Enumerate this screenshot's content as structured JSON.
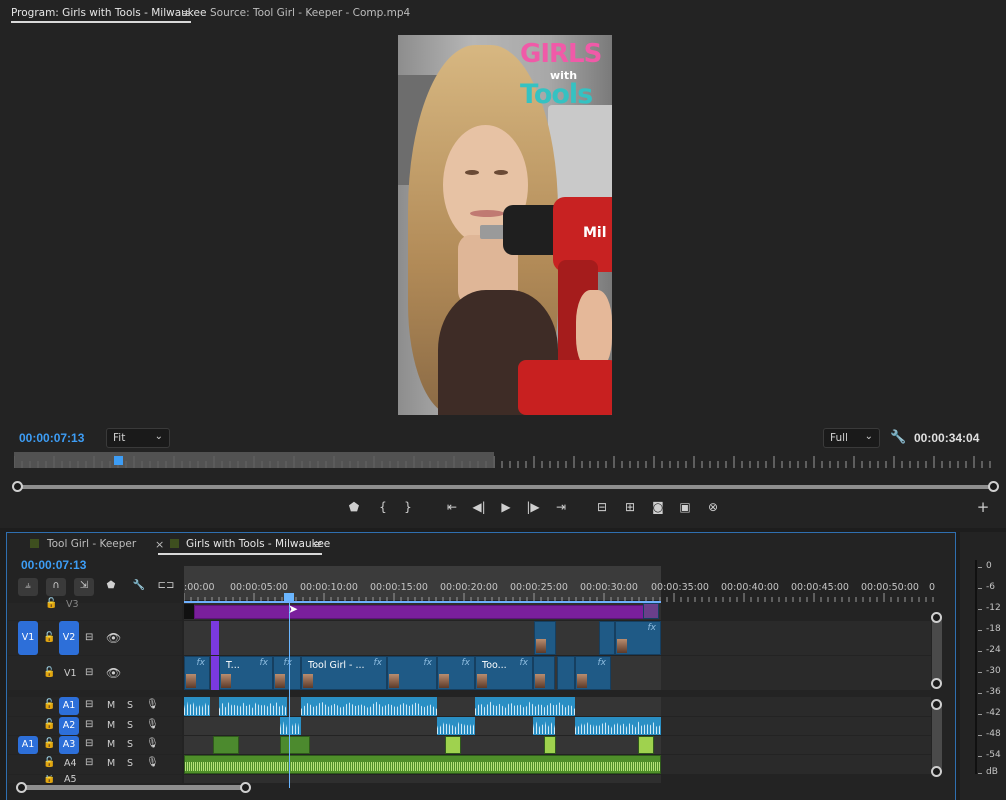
{
  "monitor": {
    "program_tab": "Program: Girls with Tools - Milwaukee",
    "menu_glyph": "≡",
    "source_tab": "Source: Tool Girl - Keeper - Comp.mp4",
    "video": {
      "title_line1": "GIRLS",
      "title_line2": "with",
      "title_line3": "Tools",
      "drill_brand": "Mil"
    },
    "timecode_current": "00:00:07:13",
    "fit_value": "Fit",
    "quality_value": "Full",
    "timecode_duration": "00:00:34:04",
    "playhead_fraction": 0.106,
    "controls": [
      "marker",
      "in",
      "out",
      "go-to-in",
      "step-back",
      "play",
      "step-forward",
      "go-to-out",
      "lift",
      "extract",
      "export-frame",
      "comparison",
      "vr",
      "add"
    ]
  },
  "timeline": {
    "tab_inactive": "Tool Girl - Keeper",
    "close_glyph": "×",
    "tab_active": "Girls with Tools - Milwaukee",
    "menu_glyph": "≡",
    "timecode": "00:00:07:13",
    "ruler_labels": [
      ":00:00",
      "00:00:05:00",
      "00:00:10:00",
      "00:00:15:00",
      "00:00:20:00",
      "00:00:25:00",
      "00:00:30:00",
      "00:00:35:00",
      "00:00:40:00",
      "00:00:45:00",
      "00:00:50:00",
      "0"
    ],
    "tracks": {
      "v3": "V3",
      "v2_source": "V1",
      "v2": "V2",
      "v1": "V1",
      "a1": "A1",
      "a2": "A2",
      "a3_source": "A1",
      "a3": "A3",
      "a4": "A4",
      "a5": "A5",
      "mute": "M",
      "solo": "S"
    },
    "v1_clips": {
      "clip_t": "T...",
      "clip_tool_girl": "Tool Girl - ...",
      "clip_too": "Too...",
      "fx": "fx"
    }
  },
  "meter": {
    "scale": [
      "0",
      "-6",
      "-12",
      "-18",
      "-24",
      "-30",
      "-36",
      "-42",
      "-48",
      "-54",
      "dB"
    ]
  }
}
